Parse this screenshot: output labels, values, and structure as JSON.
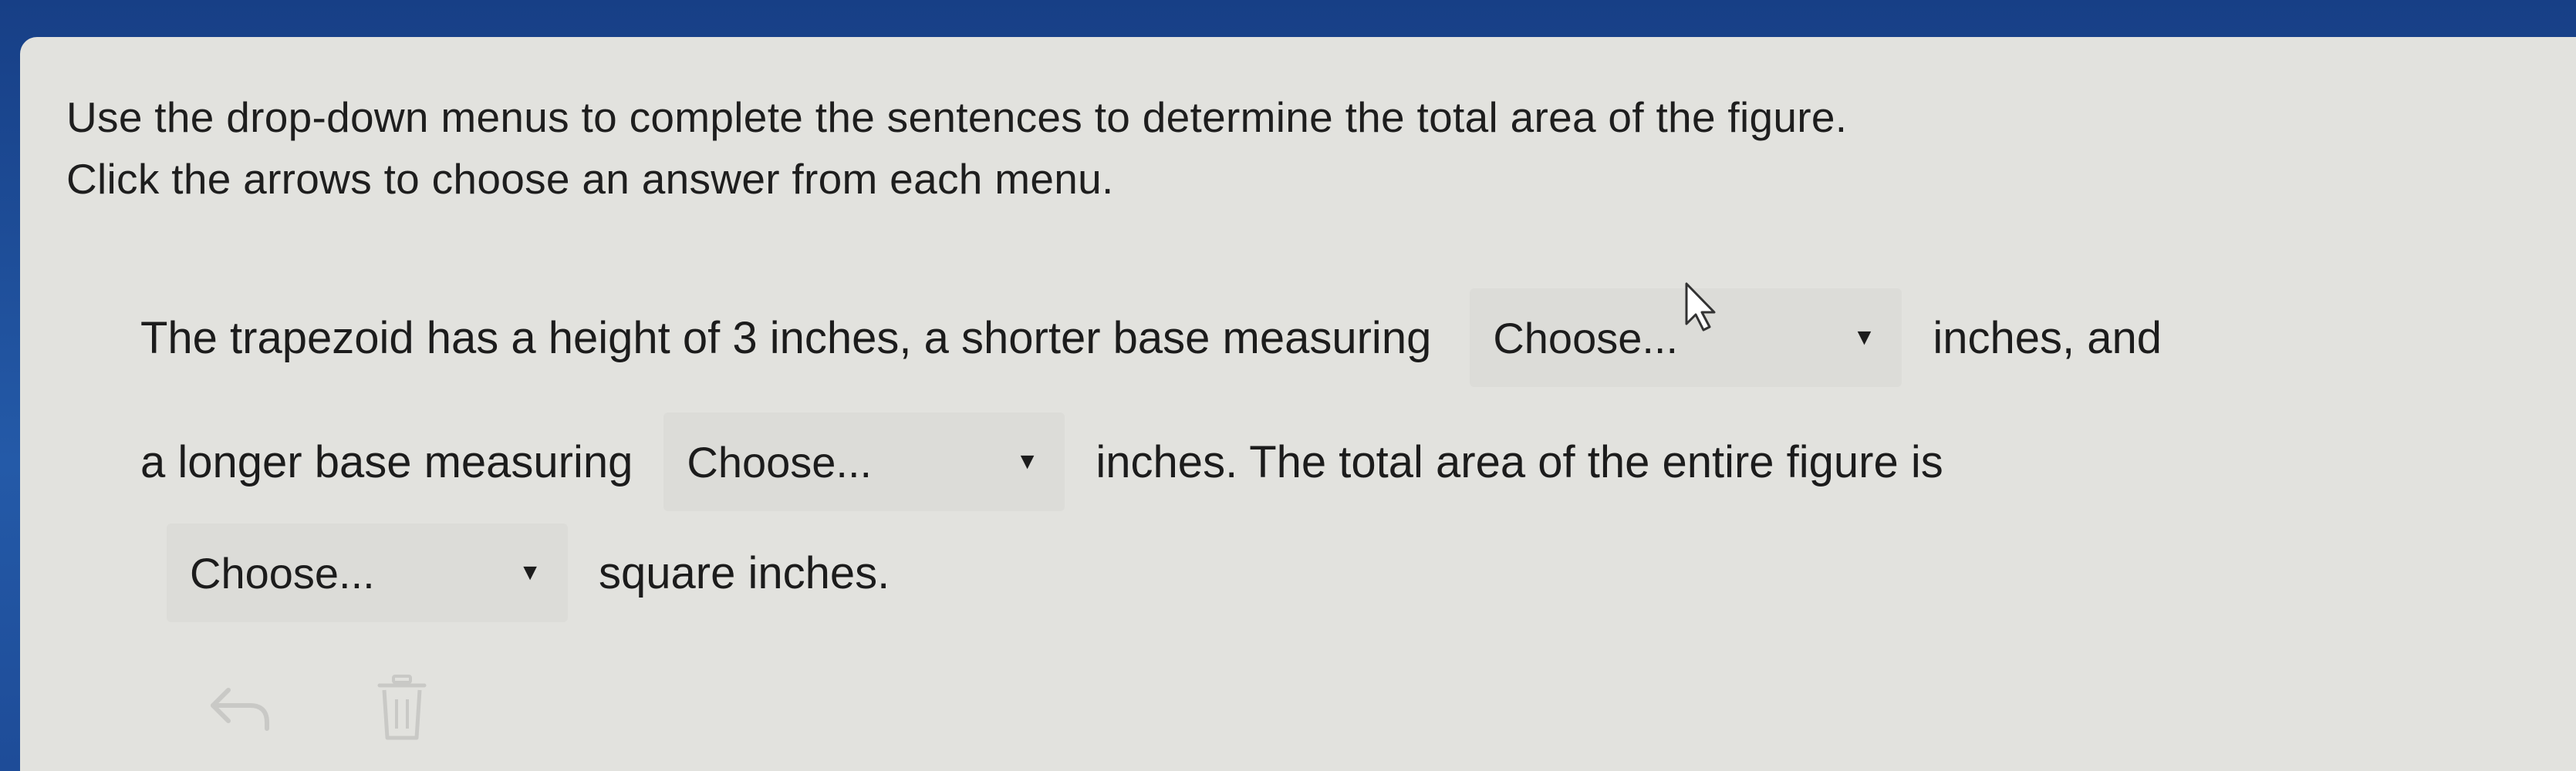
{
  "instructions": {
    "line1": "Use the drop-down menus to complete the sentences to determine the total area of the figure.",
    "line2": "Click the arrows to choose an answer from each menu."
  },
  "question": {
    "s1_before": "The trapezoid has a height of 3 inches, a shorter base measuring",
    "s1_after": "inches, and",
    "s2_before": "a longer base measuring",
    "s2_after": "inches. The total area of the entire figure is",
    "s3_after": "square inches."
  },
  "dropdowns": {
    "shorter_base": "Choose...",
    "longer_base": "Choose...",
    "total_area": "Choose..."
  },
  "toolbar": {
    "undo_icon": "undo-icon",
    "trash_icon": "trash-icon"
  },
  "colors": {
    "panel": "#e2e2de",
    "dropdown": "#dcdcd8",
    "text": "#1c1c1c",
    "background": "#1f4f9e"
  }
}
